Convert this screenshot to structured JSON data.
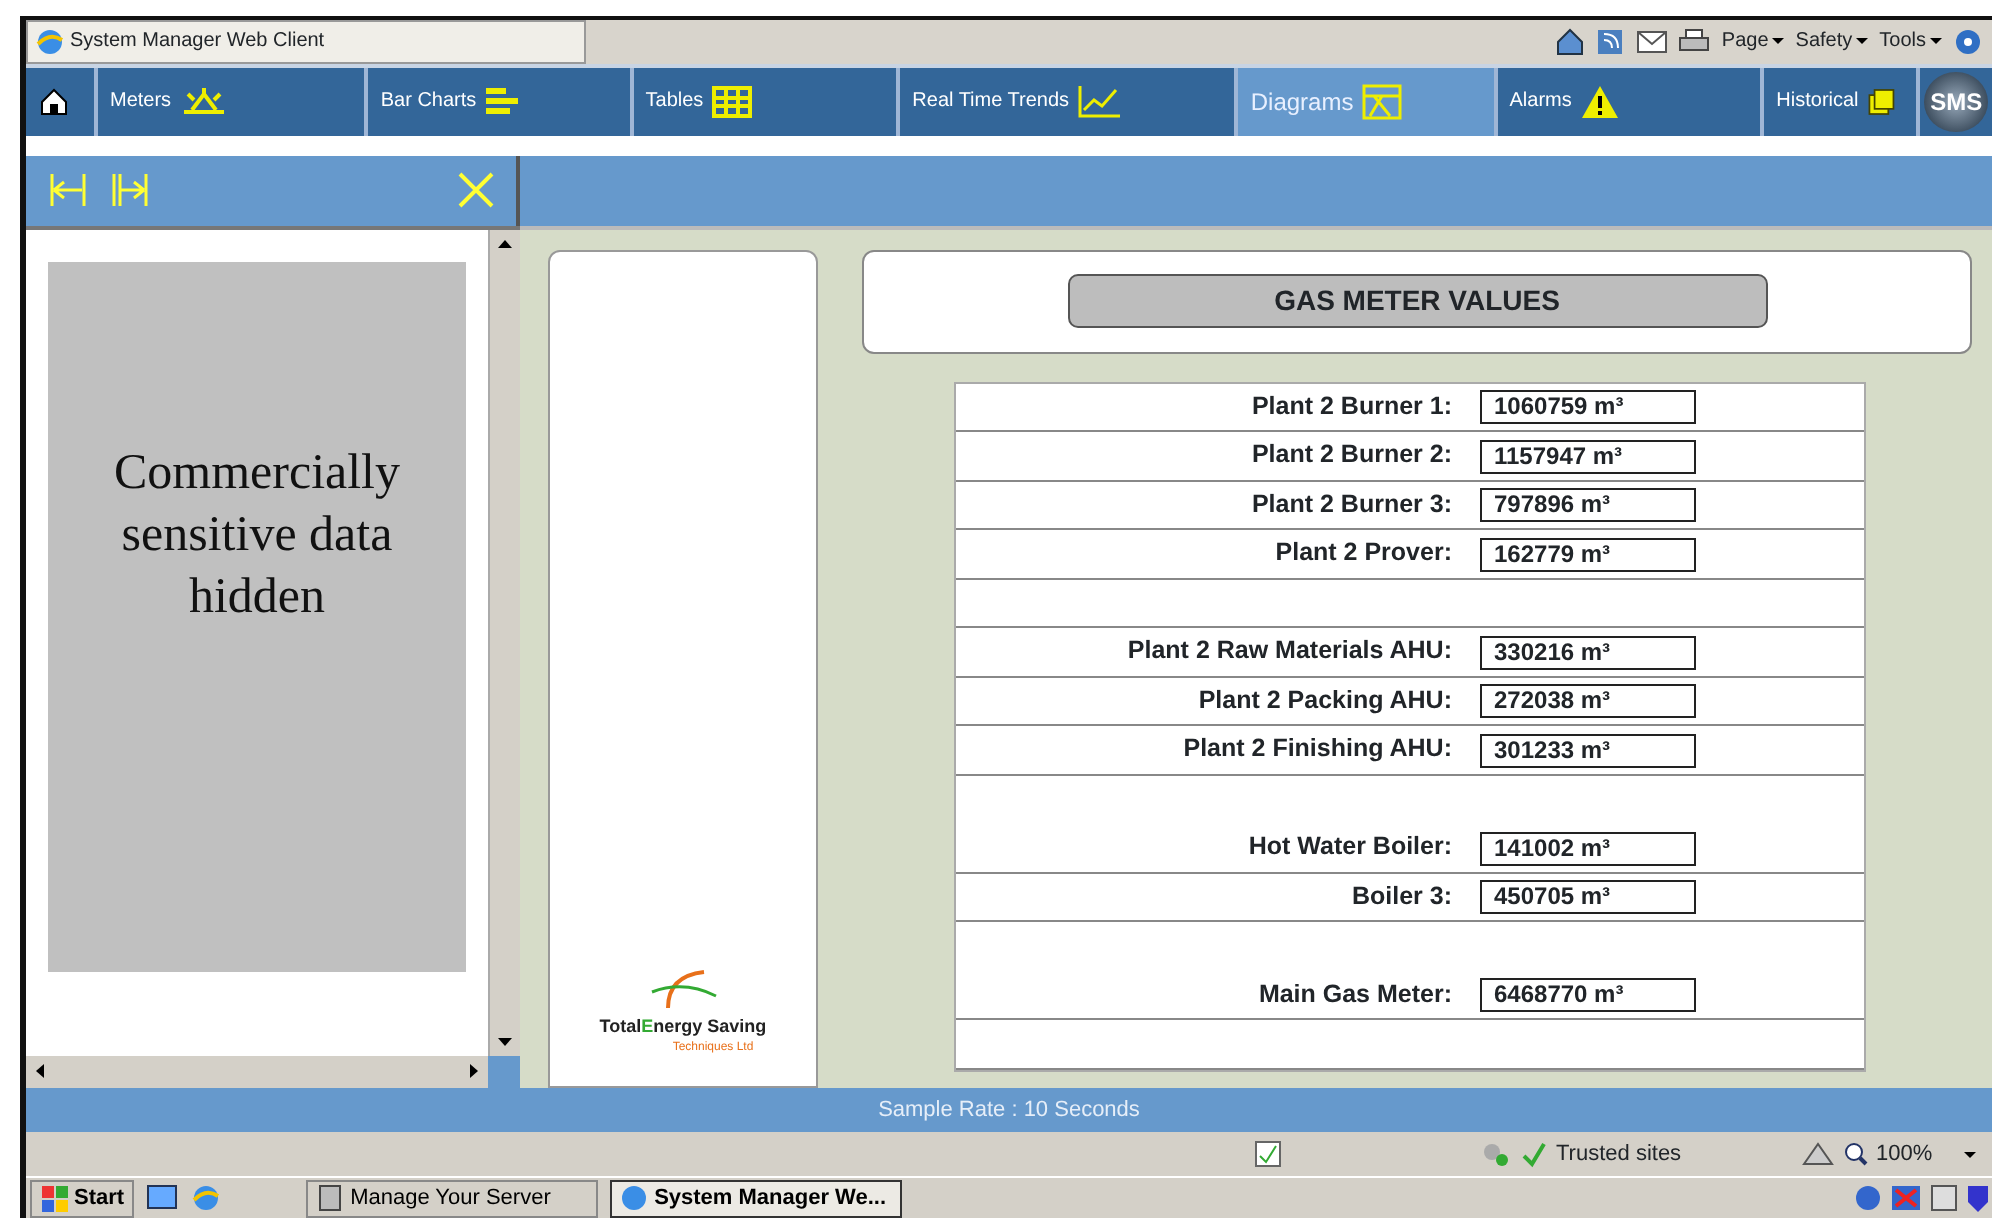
{
  "browser": {
    "tab_title": "System Manager Web Client",
    "commands": [
      "Page",
      "Safety",
      "Tools"
    ]
  },
  "nav_tabs": [
    {
      "kind": "home",
      "selected": false
    },
    {
      "kind": "meters",
      "label": "Meters",
      "selected": false
    },
    {
      "kind": "bars",
      "label": "Bar Charts",
      "selected": false
    },
    {
      "kind": "tables",
      "label": "Tables",
      "selected": false
    },
    {
      "kind": "trends",
      "label": "Real Time Trends",
      "selected": false
    },
    {
      "kind": "diagrams",
      "label": "Diagrams",
      "selected": true
    },
    {
      "kind": "alarms",
      "label": "Alarms",
      "selected": false
    },
    {
      "kind": "historical",
      "label": "Historical",
      "selected": false
    }
  ],
  "logo": {
    "text": "SMS"
  },
  "side_panel": {
    "notice": "Commercially sensitive data hidden"
  },
  "company_logo": {
    "name_start": "Total",
    "name_letter": "E",
    "name_rest": "nergy Saving",
    "tagline": "Techniques Ltd"
  },
  "diagram": {
    "title": "GAS METER VALUES",
    "rows": [
      {
        "kind": "reading",
        "label": "Plant 2 Burner 1:",
        "value": "1060759 m³"
      },
      {
        "kind": "reading",
        "label": "Plant 2 Burner 2:",
        "value": "1157947 m³"
      },
      {
        "kind": "reading",
        "label": "Plant 2 Burner 3:",
        "value": "797896 m³"
      },
      {
        "kind": "reading",
        "label": "Plant 2 Prover:",
        "value": "162779 m³"
      },
      {
        "kind": "blank"
      },
      {
        "kind": "reading",
        "label": "Plant 2 Raw Materials AHU:",
        "value": "330216 m³"
      },
      {
        "kind": "reading",
        "label": "Plant 2 Packing AHU:",
        "value": "272038 m³"
      },
      {
        "kind": "reading",
        "label": "Plant 2 Finishing AHU:",
        "value": "301233 m³"
      },
      {
        "kind": "tall_reading",
        "label": "Hot Water Boiler:",
        "value": "141002 m³"
      },
      {
        "kind": "reading",
        "label": "Boiler 3:",
        "value": "450705 m³"
      },
      {
        "kind": "tall_reading",
        "label": "Main Gas Meter:",
        "value": "6468770 m³"
      },
      {
        "kind": "blank"
      }
    ]
  },
  "sample_rate": "Sample Rate :  10 Seconds",
  "status_bar": {
    "zone": "Trusted sites",
    "zoom": "100%"
  },
  "taskbar": {
    "start": "Start",
    "windows": [
      {
        "label": "Manage Your Server",
        "selected": false
      },
      {
        "label": "System Manager We...",
        "selected": true
      }
    ]
  }
}
